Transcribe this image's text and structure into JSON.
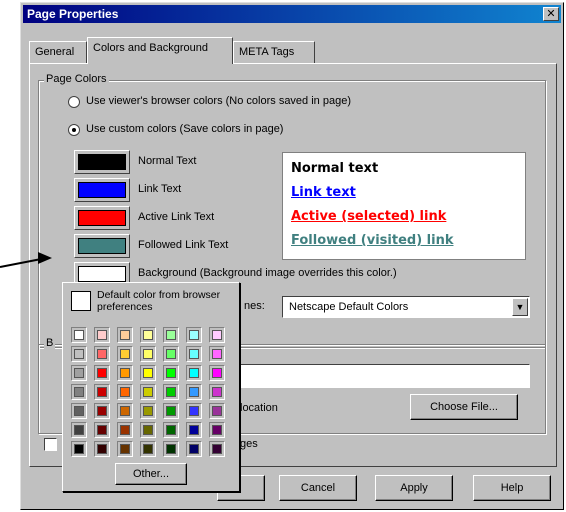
{
  "window": {
    "title": "Page Properties",
    "close_glyph": "✕"
  },
  "tabs": [
    {
      "label": "General"
    },
    {
      "label": "Colors and Background"
    },
    {
      "label": "META Tags"
    }
  ],
  "page_colors": {
    "group_label": "Page Colors",
    "radio_browser": "Use viewer's browser colors (No colors saved in page)",
    "radio_custom": "Use custom colors (Save colors in page)",
    "selected": "custom",
    "swatches": [
      {
        "label": "Normal Text",
        "color": "#000000"
      },
      {
        "label": "Link Text",
        "color": "#0000ff"
      },
      {
        "label": "Active Link Text",
        "color": "#ff0000"
      },
      {
        "label": "Followed Link Text",
        "color": "#408080"
      },
      {
        "label": "Background (Background image overrides this color.)",
        "color": "#ffffff"
      }
    ],
    "preview": {
      "normal": "Normal text",
      "link": "Link text",
      "active": "Active (selected) link",
      "followed": "Followed (visited) link"
    },
    "scheme_label_fragment": "nes:",
    "scheme_value": "Netscape Default Colors",
    "scheme_arrow_icon": "down-arrow-icon"
  },
  "background": {
    "group_label_fragment": "B",
    "location_fragment": "location",
    "choose_file_label": "Choose File...",
    "images_fragment": "ges"
  },
  "footer": {
    "cancel_label": "Cancel",
    "apply_label": "Apply",
    "help_label": "Help"
  },
  "color_popup": {
    "default_label": "Default color from browser preferences",
    "other_label": "Other...",
    "grid": [
      [
        "#ffffff",
        "#ffcccc",
        "#ffcc99",
        "#ffff99",
        "#99ff99",
        "#99ffff",
        "#ffccff"
      ],
      [
        "#c0c0c0",
        "#ff6666",
        "#ffcc33",
        "#ffff66",
        "#66ff66",
        "#66ffff",
        "#ff66ff"
      ],
      [
        "#a0a0a0",
        "#ff0000",
        "#ff9900",
        "#ffff00",
        "#00ff00",
        "#00ffff",
        "#ff00ff"
      ],
      [
        "#808080",
        "#cc0000",
        "#ff6600",
        "#cccc00",
        "#00cc00",
        "#3399ff",
        "#cc33cc"
      ],
      [
        "#606060",
        "#990000",
        "#cc6600",
        "#999900",
        "#009900",
        "#3333ff",
        "#993399"
      ],
      [
        "#404040",
        "#660000",
        "#993300",
        "#666600",
        "#006600",
        "#000099",
        "#660066"
      ],
      [
        "#000000",
        "#330000",
        "#663300",
        "#333300",
        "#003300",
        "#000066",
        "#330033"
      ]
    ]
  }
}
